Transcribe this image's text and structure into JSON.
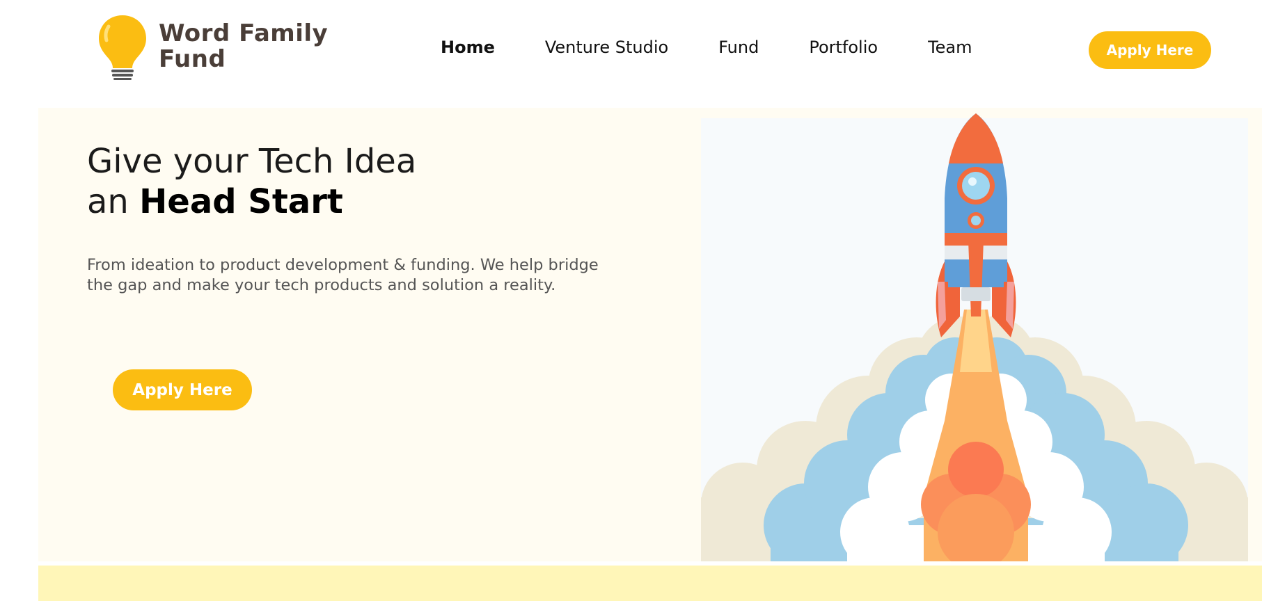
{
  "brand": {
    "name_line1": "Word Family",
    "name_line2": "Fund",
    "logo_icon": "lightbulb-icon",
    "accent_color": "#fbbd12"
  },
  "nav": {
    "items": [
      {
        "label": "Home",
        "active": true
      },
      {
        "label": "Venture Studio",
        "active": false
      },
      {
        "label": "Fund",
        "active": false
      },
      {
        "label": "Portfolio",
        "active": false
      },
      {
        "label": "Team",
        "active": false
      }
    ],
    "cta_label": "Apply Here"
  },
  "hero": {
    "title_line1": "Give your Tech Idea",
    "title_line2_prefix": "an ",
    "title_line2_bold": "Head Start",
    "description": "From ideation to product development & funding. We help bridge the gap and make your tech products and solution a reality.",
    "cta_label": "Apply Here",
    "illustration": "rocket-launch-illustration",
    "background_color": "#fffcf2"
  },
  "bottom_band": {
    "color": "#fff6b8"
  }
}
